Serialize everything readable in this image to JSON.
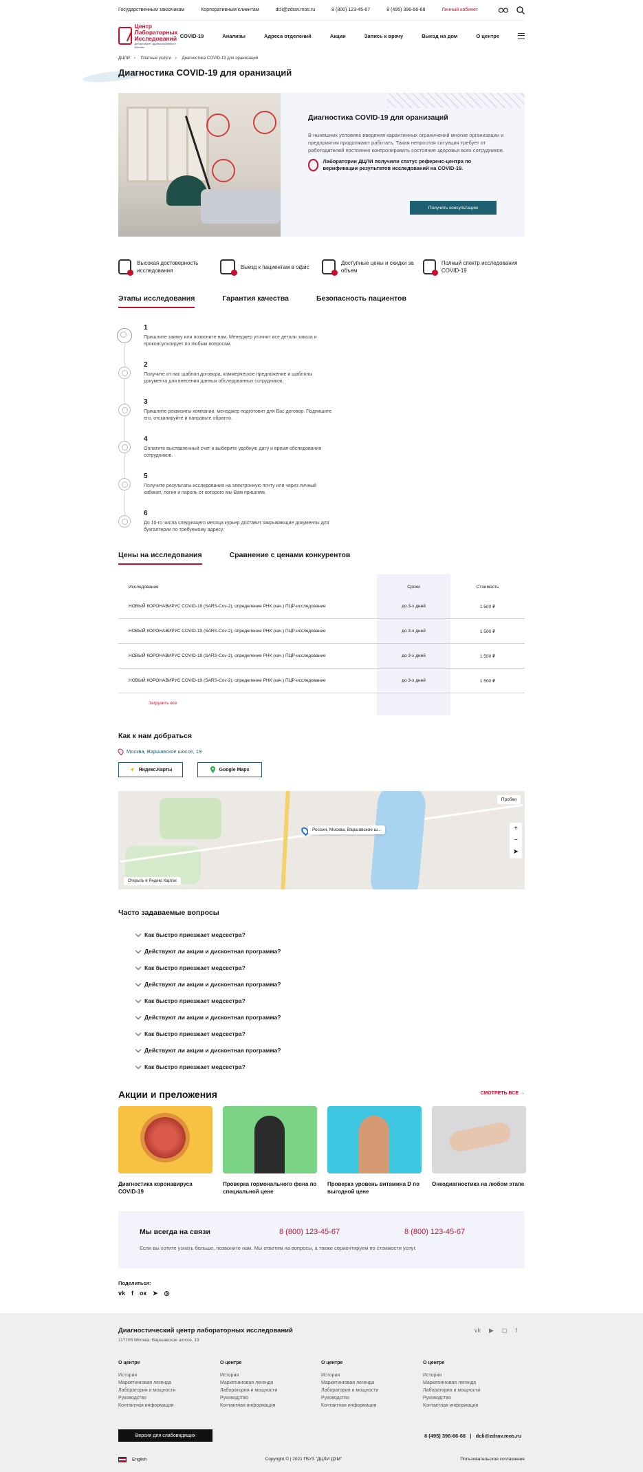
{
  "topbar": {
    "gov": "Государственным заказчикам",
    "corp": "Корпоративным клиентам",
    "email": "dcli@zdrav.mos.ru",
    "phone1": "8 (800) 123-45-67",
    "phone2": "8 (495) 396-66-68",
    "cabinet": "Личный кабинет"
  },
  "logo": {
    "line1": "Центр",
    "line2": "Лабораторных",
    "line3": "Исследований",
    "sub": "Департамент здравоохранения г. Москвы"
  },
  "nav": [
    "COVID-19",
    "Анализы",
    "Адреса отделений",
    "Акции",
    "Запись к врачу",
    "Выезд на дом",
    "О центре"
  ],
  "breadcrumbs": [
    "ДЦЛИ",
    "Платные услуги",
    "Диагностика COVID-19 для оранизаций"
  ],
  "page_title": "Диагностика COVID-19 для оранизаций",
  "hero": {
    "title": "Диагностика COVID-19 для оранизаций",
    "desc": "В нынешних условиях введения карантинных ограничений многие организации и предприятия продолжают работать. Такая непростая ситуация требует от работодателей постоянно контролировать состояние здоровья всех сотрудников.",
    "badge": "Лаборатории ДЦЛИ получили статус референс-центра по верификации результатов исследований на COVID-19.",
    "button": "Получить консультацию"
  },
  "features": [
    "Высокая достоверность исследования",
    "Выезд к пациентам в офис",
    "Доступные цены и скидки за объем",
    "Полный спектр исследования COVID-19"
  ],
  "tabs1": [
    "Этапы исследования",
    "Гарантия качества",
    "Безопасность пациентов"
  ],
  "steps": [
    {
      "n": "1",
      "t": "Пришлите заявку или позвоните нам. Менеджер уточнит все детали заказа и проконсультирует по любым вопросам."
    },
    {
      "n": "2",
      "t": "Получите от нас шаблон договора, коммерческое предложение и шаблоны документа для внесения данных обследованных сотрудников."
    },
    {
      "n": "3",
      "t": "Пришлите реквизиты компании, менеджер подготовит для Вас договор. Подпишите его, отсканируйте и направьте обратно."
    },
    {
      "n": "4",
      "t": "Оплатите выставленный счет и выберите удобную дату и время обследования сотрудников."
    },
    {
      "n": "5",
      "t": "Получите результаты исследования на электронную почту или через личный кабинет, логин и пароль от которого мы Вам пришлем."
    },
    {
      "n": "6",
      "t": "До 10-го числа следующего месяца курьер доставит закрывающие документы для бухгалтерии по требуемому адресу."
    }
  ],
  "tabs2": [
    "Цены на исследования",
    "Сравнение с ценами конкурентов"
  ],
  "prices": {
    "headers": [
      "Исследование",
      "Сроки",
      "Стоимость"
    ],
    "rows": [
      [
        "НОВЫЙ КОРОНАВИРУС COVID-19 (SARS-Cov-2), определение РНК (кач.) ПЦР-исследование",
        "до 3-х дней",
        "1 500 ₽"
      ],
      [
        "НОВЫЙ КОРОНАВИРУС COVID-19 (SARS-Cov-2), определение РНК (кач.) ПЦР-исследование",
        "до 3-х дней",
        "1 500 ₽"
      ],
      [
        "НОВЫЙ КОРОНАВИРУС COVID-19 (SARS-Cov-2), определение РНК (кач.) ПЦР-исследование",
        "до 3-х дней",
        "1 500 ₽"
      ],
      [
        "НОВЫЙ КОРОНАВИРУС COVID-19 (SARS-Cov-2), определение РНК (кач.) ПЦР-исследование",
        "до 3-х дней",
        "1 500 ₽"
      ]
    ],
    "load_more": "Загрузить все"
  },
  "how": {
    "title": "Как к нам добраться",
    "address": "Москва, Варшавское шоссе, 19",
    "yandex": "Яндекс.Карты",
    "google": "Google Maps",
    "map_label": "Россия, Москва, Варшавское ш...",
    "open_link": "Открыть в Яндекс Картах",
    "traffic": "Пробки"
  },
  "faq": {
    "title": "Часто задаваемые вопросы",
    "items": [
      "Как быстро приезжает медсестра?",
      "Действуют ли акции и дисконтная программа?",
      "Как быстро приезжает медсестра?",
      "Действуют ли акции и дисконтная программа?",
      "Как быстро приезжает медсестра?",
      "Действуют ли акции и дисконтная программа?",
      "Как быстро приезжает медсестра?",
      "Действуют ли акции и дисконтная программа?",
      "Как быстро приезжает медсестра?"
    ]
  },
  "promos": {
    "title": "Акции и преложения",
    "see_all": "СМОТРЕТЬ ВСЕ →",
    "items": [
      {
        "caption": "Диагностика коронавируса COVID-19",
        "color": "#f7c142"
      },
      {
        "caption": "Проверка гормонального фона по специальной цене",
        "color": "#7bd486"
      },
      {
        "caption": "Проверка уровень витамина D по выгодной цене",
        "color": "#3fc6e0"
      },
      {
        "caption": "Онкодиагностика на любом этапе",
        "color": "#d9d9dc"
      }
    ]
  },
  "contact": {
    "title": "Мы всегда на связи",
    "phone1": "8 (800) 123-45-67",
    "phone2": "8 (800) 123-45-67",
    "desc": "Если вы хотите узнать больше, позвоните нам. Мы ответим на вопросы, а также сориентируем по стоимости услуг."
  },
  "share": {
    "label": "Поделиться:",
    "icons": [
      "vk-icon",
      "facebook-icon",
      "odnoklassniki-icon",
      "telegram-icon",
      "whatsapp-icon"
    ]
  },
  "footer": {
    "title": "Диагностический центр лабораторных исследований",
    "address": "117105 Москва, Варшавское шоссе, 19",
    "columns": [
      {
        "head": "О центре",
        "items": [
          "История",
          "Маркетинговая легенда",
          "Лаборатория и мощности",
          "Руководство",
          "Контактная информация"
        ]
      },
      {
        "head": "О центре",
        "items": [
          "История",
          "Маркетинговая легенда",
          "Лаборатория и мощности",
          "Руководство",
          "Контактная информация"
        ]
      },
      {
        "head": "О центре",
        "items": [
          "История",
          "Маркетинговая легенда",
          "Лаборатория и мощности",
          "Руководство",
          "Контактная информация"
        ]
      },
      {
        "head": "О центре",
        "items": [
          "История",
          "Маркетинговая легенда",
          "Лаборатория и мощности",
          "Руководство",
          "Контактная информация"
        ]
      }
    ],
    "accessibility": "Версия для слабовидящих",
    "phone": "8 (495) 396-66-68",
    "email": "dcli@zdrav.mos.ru",
    "lang": "English",
    "copyright": "Copyright © | 2021 ГБУЗ \"ДЦЛИ ДЗМ\"",
    "agreement": "Пользовательское соглашение"
  }
}
